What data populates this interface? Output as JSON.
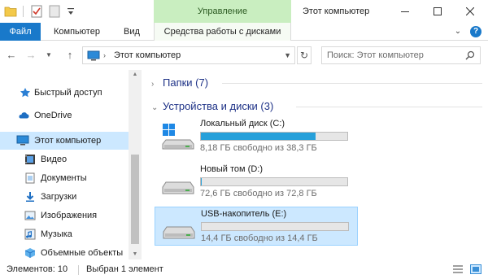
{
  "window": {
    "title": "Этот компьютер",
    "contextual_tab": "Управление"
  },
  "ribbon": {
    "tabs": [
      "Файл",
      "Компьютер",
      "Вид",
      "Средства работы с дисками"
    ]
  },
  "address": {
    "path": "Этот компьютер",
    "search_placeholder": "Поиск: Этот компьютер"
  },
  "sidebar": {
    "items": [
      {
        "label": "Быстрый доступ",
        "icon": "star-icon"
      },
      {
        "label": "OneDrive",
        "icon": "cloud-icon"
      },
      {
        "label": "Этот компьютер",
        "icon": "computer-icon",
        "selected": true
      },
      {
        "label": "Видео",
        "icon": "video-icon"
      },
      {
        "label": "Документы",
        "icon": "documents-icon"
      },
      {
        "label": "Загрузки",
        "icon": "download-icon"
      },
      {
        "label": "Изображения",
        "icon": "pictures-icon"
      },
      {
        "label": "Музыка",
        "icon": "music-icon"
      },
      {
        "label": "Объемные объекты",
        "icon": "3d-objects-icon"
      }
    ]
  },
  "main": {
    "folders_header": "Папки (7)",
    "devices_header": "Устройства и диски (3)",
    "drives": [
      {
        "name": "Локальный диск (C:)",
        "free": "8,18 ГБ свободно из 38,3 ГБ",
        "used_fraction": 0.786,
        "system": true,
        "selected": false
      },
      {
        "name": "Новый том (D:)",
        "free": "72,6 ГБ свободно из 72,8 ГБ",
        "used_fraction": 0.003,
        "system": false,
        "selected": false
      },
      {
        "name": "USB-накопитель (E:)",
        "free": "14,4 ГБ свободно из 14,4 ГБ",
        "used_fraction": 0.0,
        "system": false,
        "selected": true
      }
    ]
  },
  "status": {
    "count": "Элементов: 10",
    "selection": "Выбран 1 элемент"
  },
  "colors": {
    "accent": "#1979ca",
    "selection": "#cce8ff",
    "drive_bar": "#26a0da",
    "contextual_tab": "#c9eec0"
  }
}
